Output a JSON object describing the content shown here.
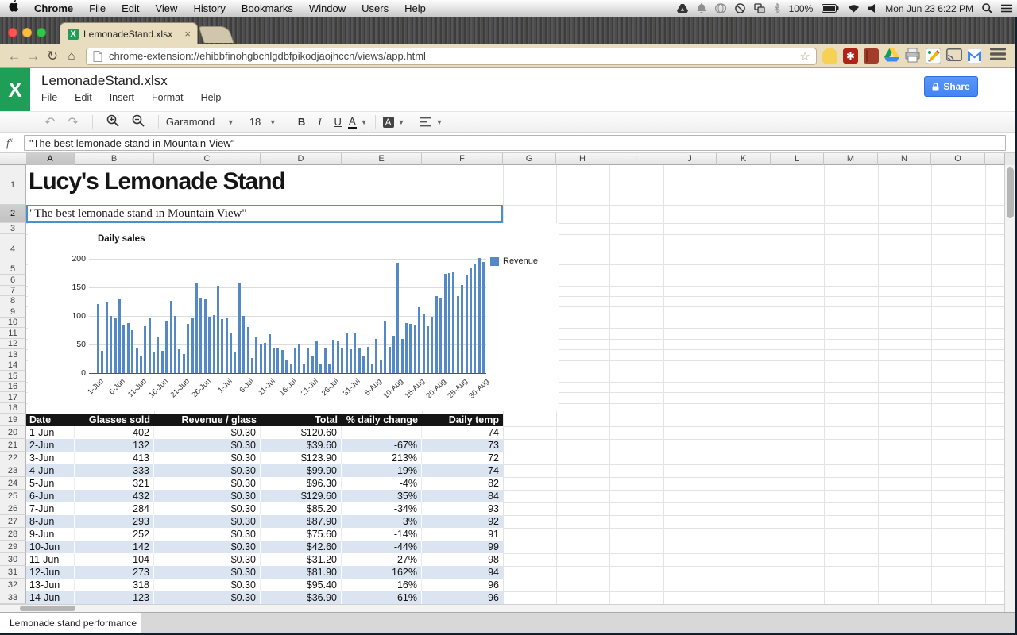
{
  "menubar": {
    "items": [
      "Chrome",
      "File",
      "Edit",
      "View",
      "History",
      "Bookmarks",
      "Window",
      "Users",
      "Help"
    ],
    "battery": "100%",
    "clock": "Mon Jun 23 6:22 PM"
  },
  "browser": {
    "tab_title": "LemonadeStand.xlsx",
    "tab_close": "×",
    "url": "chrome-extension://ehibbfinohgbchlgdbfpikodjaojhccn/views/app.html"
  },
  "app": {
    "logo_letter": "X",
    "title": "LemonadeStand.xlsx",
    "menus": [
      "File",
      "Edit",
      "Insert",
      "Format",
      "Help"
    ],
    "share_label": "Share"
  },
  "toolbar": {
    "undo": "↶",
    "redo": "↷",
    "font": "Garamond",
    "size": "18",
    "bold": "B",
    "italic": "I",
    "underline": "U",
    "text_color": "A",
    "fill_color": "A"
  },
  "formula_bar": {
    "fx_f": "f",
    "fx_x": "x",
    "value": "\"The best lemonade stand in Mountain View\""
  },
  "sheet": {
    "columns": [
      "A",
      "B",
      "C",
      "D",
      "E",
      "F",
      "G",
      "H",
      "I",
      "J",
      "K",
      "L",
      "M",
      "N",
      "O"
    ],
    "row_numbers": [
      "1",
      "2",
      "3",
      "4",
      "5",
      "6",
      "7",
      "8",
      "9",
      "10",
      "11",
      "12",
      "13",
      "14",
      "15",
      "16",
      "17",
      "18",
      "19",
      "20",
      "21",
      "22",
      "23",
      "24",
      "25",
      "26",
      "27",
      "28",
      "29",
      "30",
      "31",
      "32",
      "33"
    ],
    "selected_column": "A",
    "selected_row": "2",
    "title_cell": "Lucy's Lemonade Stand",
    "subtitle_cell": "\"The best lemonade stand in Mountain View\"",
    "sheet_tab": "Lemonade stand performance"
  },
  "chart_data": {
    "type": "bar",
    "title": "Daily sales",
    "series": [
      {
        "name": "Revenue",
        "color": "#5488c7"
      }
    ],
    "ylim": [
      0,
      200
    ],
    "yticks": [
      0,
      50,
      100,
      150,
      200
    ],
    "grid": true,
    "legend_position": "top-right",
    "x_tick_indices": [
      0,
      5,
      10,
      15,
      20,
      25,
      30,
      35,
      40,
      45,
      50,
      55,
      60,
      65,
      70,
      75,
      80,
      85,
      90
    ],
    "x_tick_labels": [
      "1-Jun",
      "6-Jun",
      "11-Jun",
      "16-Jun",
      "21-Jun",
      "26-Jun",
      "1-Jul",
      "6-Jul",
      "11-Jul",
      "16-Jul",
      "21-Jul",
      "26-Jul",
      "31-Jul",
      "5-Aug",
      "10-Aug",
      "15-Aug",
      "20-Aug",
      "25-Aug",
      "30-Aug"
    ],
    "values": [
      120.6,
      39.6,
      123.9,
      99.9,
      96.3,
      129.6,
      85.2,
      87.9,
      75.6,
      42.6,
      31.2,
      81.9,
      95.4,
      36.9,
      63,
      39,
      90,
      127,
      100,
      41,
      33,
      86,
      96,
      159,
      131,
      129,
      99,
      101,
      153,
      94,
      97,
      70,
      38,
      159,
      100,
      81,
      26,
      64,
      52,
      53,
      68,
      45,
      45,
      40,
      22,
      16,
      44,
      50,
      17,
      43,
      30,
      57,
      17,
      44,
      15,
      59,
      55,
      44,
      71,
      41,
      69,
      43,
      31,
      46,
      16,
      60,
      23,
      90,
      46,
      65,
      193,
      60,
      88,
      86,
      83,
      115,
      104,
      82,
      99,
      135,
      131,
      174,
      175,
      176,
      135,
      154,
      172,
      183,
      191,
      201,
      195
    ]
  },
  "table": {
    "headers": [
      "Date",
      "Glasses sold",
      "Revenue / glass",
      "Total",
      "% daily change",
      "Daily temp"
    ],
    "rows": [
      [
        "1-Jun",
        "402",
        "$0.30",
        "$120.60",
        "--",
        "74"
      ],
      [
        "2-Jun",
        "132",
        "$0.30",
        "$39.60",
        "-67%",
        "73"
      ],
      [
        "3-Jun",
        "413",
        "$0.30",
        "$123.90",
        "213%",
        "72"
      ],
      [
        "4-Jun",
        "333",
        "$0.30",
        "$99.90",
        "-19%",
        "74"
      ],
      [
        "5-Jun",
        "321",
        "$0.30",
        "$96.30",
        "-4%",
        "82"
      ],
      [
        "6-Jun",
        "432",
        "$0.30",
        "$129.60",
        "35%",
        "84"
      ],
      [
        "7-Jun",
        "284",
        "$0.30",
        "$85.20",
        "-34%",
        "93"
      ],
      [
        "8-Jun",
        "293",
        "$0.30",
        "$87.90",
        "3%",
        "92"
      ],
      [
        "9-Jun",
        "252",
        "$0.30",
        "$75.60",
        "-14%",
        "91"
      ],
      [
        "10-Jun",
        "142",
        "$0.30",
        "$42.60",
        "-44%",
        "99"
      ],
      [
        "11-Jun",
        "104",
        "$0.30",
        "$31.20",
        "-27%",
        "98"
      ],
      [
        "12-Jun",
        "273",
        "$0.30",
        "$81.90",
        "162%",
        "94"
      ],
      [
        "13-Jun",
        "318",
        "$0.30",
        "$95.40",
        "16%",
        "96"
      ],
      [
        "14-Jun",
        "123",
        "$0.30",
        "$36.90",
        "-61%",
        "96"
      ]
    ],
    "band_color": "#dbe5f1"
  }
}
